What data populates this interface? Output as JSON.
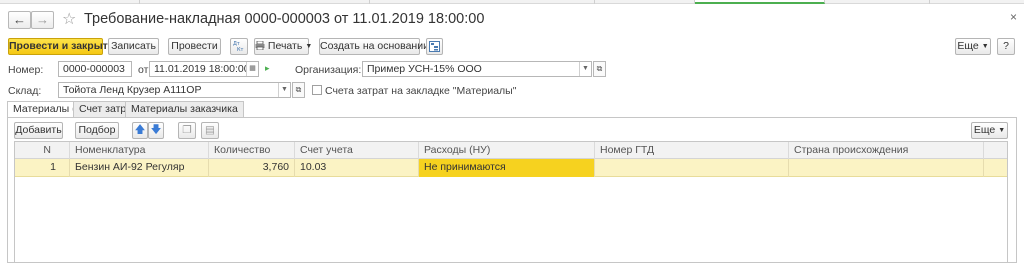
{
  "window": {
    "title": "Требование-накладная 0000-000003 от 11.01.2019 18:00:00",
    "close_glyph": "×",
    "back_glyph": "←",
    "forward_glyph": "→",
    "star_glyph": "☆"
  },
  "toolbar": {
    "post_and_close": "Провести и закрыть",
    "save": "Записать",
    "post": "Провести",
    "print": "Печать",
    "create_based_on": "Создать на основании",
    "more": "Еще",
    "help": "?"
  },
  "form": {
    "number_label": "Номер:",
    "number_value": "0000-000003",
    "date_label": "от:",
    "date_value": "11.01.2019 18:00:00",
    "org_label": "Организация:",
    "org_value": "Пример УСН-15% ООО",
    "warehouse_label": "Склад:",
    "warehouse_value": "Тойота Ленд Крузер А111ОР",
    "cost_accounts_checkbox_label": "Счета затрат на закладке \"Материалы\"",
    "cost_accounts_checked": false
  },
  "tabs": [
    {
      "label": "Материалы (1)",
      "active": true
    },
    {
      "label": "Счет затрат",
      "active": false
    },
    {
      "label": "Материалы заказчика",
      "active": false
    }
  ],
  "materials_toolbar": {
    "add": "Добавить",
    "select": "Подбор",
    "more": "Еще"
  },
  "table": {
    "columns": [
      "N",
      "Номенклатура",
      "Количество",
      "Счет учета",
      "Расходы (НУ)",
      "Номер ГТД",
      "Страна происхождения"
    ],
    "rows": [
      {
        "n": "1",
        "item": "Бензин АИ-92 Регуляр",
        "qty": "3,760",
        "account": "10.03",
        "expenses": "Не принимаются",
        "gtd": "",
        "country": ""
      }
    ]
  },
  "colors": {
    "primary_button": "#f5c813",
    "selected_row": "#fbf3c4",
    "highlight_cell": "#f6d21f",
    "active_tab_underline": "#4caf50"
  }
}
